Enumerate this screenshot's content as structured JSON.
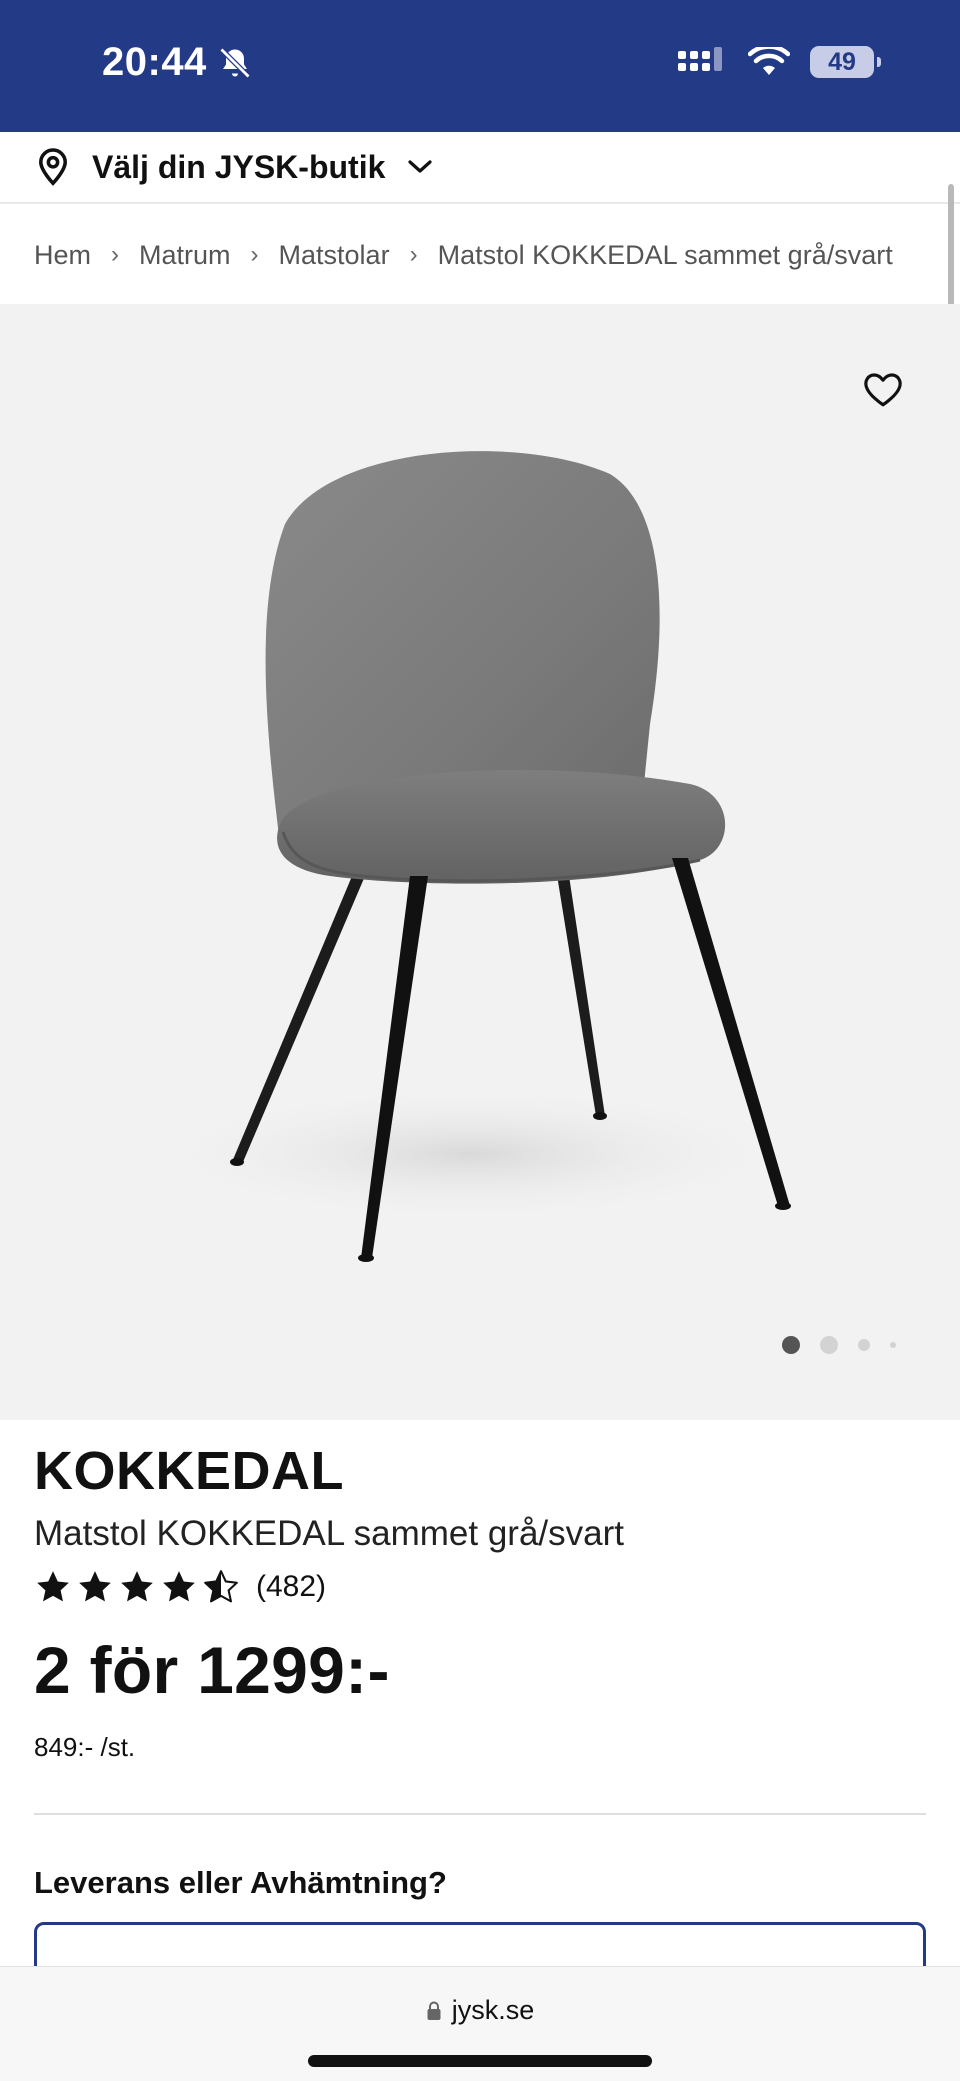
{
  "status_bar": {
    "time": "20:44",
    "battery": "49",
    "background": "#233a87"
  },
  "store_selector": {
    "label": "Välj din JYSK-butik",
    "icon": "location-pin-icon",
    "chevron": "chevron-down-icon"
  },
  "breadcrumb": [
    "Hem",
    "Matrum",
    "Matstolar",
    "Matstol KOKKEDAL sammet grå/svart"
  ],
  "gallery": {
    "favorite_icon": "heart-outline-icon",
    "image": "chair-product-image",
    "page_count": 4,
    "active_index": 0
  },
  "product": {
    "brand": "KOKKEDAL",
    "name": "Matstol KOKKEDAL sammet grå/svart",
    "rating": 4.5,
    "rating_max": 5,
    "review_count": "(482)",
    "price": "2 för 1299:-",
    "unit_price": "849:- /st."
  },
  "delivery": {
    "title": "Leverans eller Avhämtning?"
  },
  "browser": {
    "url": "jysk.se",
    "lock_icon": "lock-icon"
  }
}
